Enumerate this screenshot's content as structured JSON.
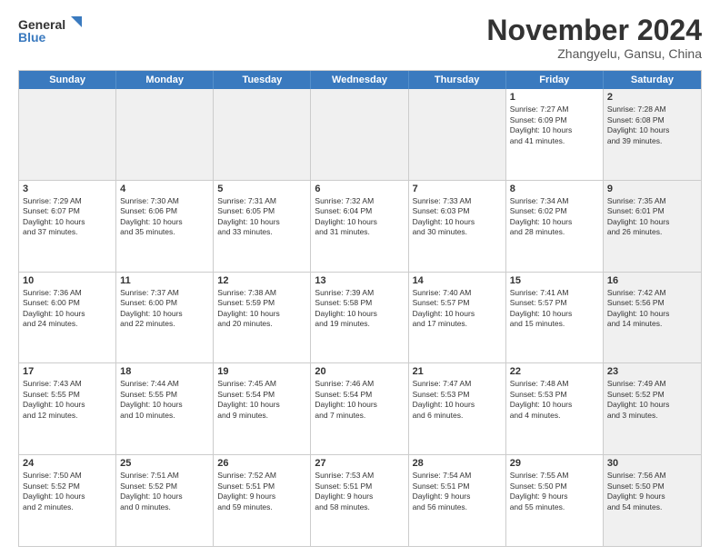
{
  "logo": {
    "line1": "General",
    "line2": "Blue"
  },
  "title": "November 2024",
  "subtitle": "Zhangyelu, Gansu, China",
  "header_days": [
    "Sunday",
    "Monday",
    "Tuesday",
    "Wednesday",
    "Thursday",
    "Friday",
    "Saturday"
  ],
  "weeks": [
    [
      {
        "day": "",
        "text": "",
        "shaded": true
      },
      {
        "day": "",
        "text": "",
        "shaded": true
      },
      {
        "day": "",
        "text": "",
        "shaded": true
      },
      {
        "day": "",
        "text": "",
        "shaded": true
      },
      {
        "day": "",
        "text": "",
        "shaded": true
      },
      {
        "day": "1",
        "text": "Sunrise: 7:27 AM\nSunset: 6:09 PM\nDaylight: 10 hours\nand 41 minutes.",
        "shaded": false
      },
      {
        "day": "2",
        "text": "Sunrise: 7:28 AM\nSunset: 6:08 PM\nDaylight: 10 hours\nand 39 minutes.",
        "shaded": true
      }
    ],
    [
      {
        "day": "3",
        "text": "Sunrise: 7:29 AM\nSunset: 6:07 PM\nDaylight: 10 hours\nand 37 minutes.",
        "shaded": false
      },
      {
        "day": "4",
        "text": "Sunrise: 7:30 AM\nSunset: 6:06 PM\nDaylight: 10 hours\nand 35 minutes.",
        "shaded": false
      },
      {
        "day": "5",
        "text": "Sunrise: 7:31 AM\nSunset: 6:05 PM\nDaylight: 10 hours\nand 33 minutes.",
        "shaded": false
      },
      {
        "day": "6",
        "text": "Sunrise: 7:32 AM\nSunset: 6:04 PM\nDaylight: 10 hours\nand 31 minutes.",
        "shaded": false
      },
      {
        "day": "7",
        "text": "Sunrise: 7:33 AM\nSunset: 6:03 PM\nDaylight: 10 hours\nand 30 minutes.",
        "shaded": false
      },
      {
        "day": "8",
        "text": "Sunrise: 7:34 AM\nSunset: 6:02 PM\nDaylight: 10 hours\nand 28 minutes.",
        "shaded": false
      },
      {
        "day": "9",
        "text": "Sunrise: 7:35 AM\nSunset: 6:01 PM\nDaylight: 10 hours\nand 26 minutes.",
        "shaded": true
      }
    ],
    [
      {
        "day": "10",
        "text": "Sunrise: 7:36 AM\nSunset: 6:00 PM\nDaylight: 10 hours\nand 24 minutes.",
        "shaded": false
      },
      {
        "day": "11",
        "text": "Sunrise: 7:37 AM\nSunset: 6:00 PM\nDaylight: 10 hours\nand 22 minutes.",
        "shaded": false
      },
      {
        "day": "12",
        "text": "Sunrise: 7:38 AM\nSunset: 5:59 PM\nDaylight: 10 hours\nand 20 minutes.",
        "shaded": false
      },
      {
        "day": "13",
        "text": "Sunrise: 7:39 AM\nSunset: 5:58 PM\nDaylight: 10 hours\nand 19 minutes.",
        "shaded": false
      },
      {
        "day": "14",
        "text": "Sunrise: 7:40 AM\nSunset: 5:57 PM\nDaylight: 10 hours\nand 17 minutes.",
        "shaded": false
      },
      {
        "day": "15",
        "text": "Sunrise: 7:41 AM\nSunset: 5:57 PM\nDaylight: 10 hours\nand 15 minutes.",
        "shaded": false
      },
      {
        "day": "16",
        "text": "Sunrise: 7:42 AM\nSunset: 5:56 PM\nDaylight: 10 hours\nand 14 minutes.",
        "shaded": true
      }
    ],
    [
      {
        "day": "17",
        "text": "Sunrise: 7:43 AM\nSunset: 5:55 PM\nDaylight: 10 hours\nand 12 minutes.",
        "shaded": false
      },
      {
        "day": "18",
        "text": "Sunrise: 7:44 AM\nSunset: 5:55 PM\nDaylight: 10 hours\nand 10 minutes.",
        "shaded": false
      },
      {
        "day": "19",
        "text": "Sunrise: 7:45 AM\nSunset: 5:54 PM\nDaylight: 10 hours\nand 9 minutes.",
        "shaded": false
      },
      {
        "day": "20",
        "text": "Sunrise: 7:46 AM\nSunset: 5:54 PM\nDaylight: 10 hours\nand 7 minutes.",
        "shaded": false
      },
      {
        "day": "21",
        "text": "Sunrise: 7:47 AM\nSunset: 5:53 PM\nDaylight: 10 hours\nand 6 minutes.",
        "shaded": false
      },
      {
        "day": "22",
        "text": "Sunrise: 7:48 AM\nSunset: 5:53 PM\nDaylight: 10 hours\nand 4 minutes.",
        "shaded": false
      },
      {
        "day": "23",
        "text": "Sunrise: 7:49 AM\nSunset: 5:52 PM\nDaylight: 10 hours\nand 3 minutes.",
        "shaded": true
      }
    ],
    [
      {
        "day": "24",
        "text": "Sunrise: 7:50 AM\nSunset: 5:52 PM\nDaylight: 10 hours\nand 2 minutes.",
        "shaded": false
      },
      {
        "day": "25",
        "text": "Sunrise: 7:51 AM\nSunset: 5:52 PM\nDaylight: 10 hours\nand 0 minutes.",
        "shaded": false
      },
      {
        "day": "26",
        "text": "Sunrise: 7:52 AM\nSunset: 5:51 PM\nDaylight: 9 hours\nand 59 minutes.",
        "shaded": false
      },
      {
        "day": "27",
        "text": "Sunrise: 7:53 AM\nSunset: 5:51 PM\nDaylight: 9 hours\nand 58 minutes.",
        "shaded": false
      },
      {
        "day": "28",
        "text": "Sunrise: 7:54 AM\nSunset: 5:51 PM\nDaylight: 9 hours\nand 56 minutes.",
        "shaded": false
      },
      {
        "day": "29",
        "text": "Sunrise: 7:55 AM\nSunset: 5:50 PM\nDaylight: 9 hours\nand 55 minutes.",
        "shaded": false
      },
      {
        "day": "30",
        "text": "Sunrise: 7:56 AM\nSunset: 5:50 PM\nDaylight: 9 hours\nand 54 minutes.",
        "shaded": true
      }
    ]
  ]
}
